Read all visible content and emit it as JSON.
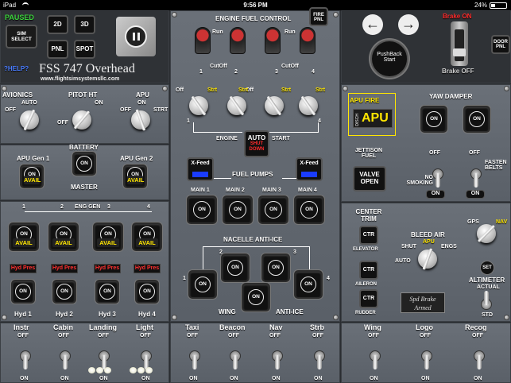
{
  "status": {
    "device": "iPad",
    "wifi": "wifi-icon",
    "time": "9:56 PM",
    "battery": "24%"
  },
  "left": {
    "paused": "PAUSED",
    "sim_select": "SIM SELECT",
    "b2d": "2D",
    "b3d": "3D",
    "pnl": "PNL",
    "spot": "SPOT",
    "help": "?HELP?",
    "title": "FSS 747 Overhead",
    "url": "www.flightsimsystemsllc.com",
    "avionics": "AVIONICS",
    "auto": "AUTO",
    "off": "OFF",
    "on": "ON",
    "pitot": "PITOT HT",
    "apu": "APU",
    "strt": "STRT",
    "apu_gen1": "APU Gen 1",
    "apu_gen2": "APU Gen 2",
    "battery": "BATTERY",
    "master": "MASTER",
    "avail": "AVAIL",
    "eng_gen": "ENG GEN",
    "nums": [
      "1",
      "2",
      "3",
      "4"
    ],
    "hyd_pres": "Hyd Pres",
    "hyd": [
      "Hyd 1",
      "Hyd 2",
      "Hyd 3",
      "Hyd 4"
    ]
  },
  "mid": {
    "fire_pnl": "FIRE PNL",
    "eng_fuel": "ENGINE FUEL CONTROL",
    "run": "Run",
    "cutoff": "CutOff",
    "off": "Off",
    "strt": "Strt",
    "nums": [
      "1",
      "2",
      "3",
      "4"
    ],
    "engine": "ENGINE",
    "start": "START",
    "auto": "AUTO",
    "shutdown": "SHUT DOWN",
    "xfeed": "X-Feed",
    "fuel_pumps": "FUEL PUMPS",
    "mains": [
      "MAIN 1",
      "MAIN 2",
      "MAIN 3",
      "MAIN 4"
    ],
    "nacelle": "NACELLE ANTI-ICE",
    "wing": "WING",
    "anti_ice": "ANTI-ICE",
    "on": "ON"
  },
  "right": {
    "brake_on": "Brake ON",
    "brake_off": "Brake OFF",
    "pushback": "PushBack Start",
    "door_pnl": "DOOR PNL",
    "apu_fire": "APU FIRE",
    "disch": "DISCH",
    "apu": "APU",
    "yaw_damper": "YAW DAMPER",
    "jettison": "JETTISON FUEL",
    "valve_open": "VALVE OPEN",
    "off": "OFF",
    "no_smoking": "NO SMOKING",
    "fasten_belts": "FASTEN BELTS",
    "on": "ON",
    "center_trim": "CENTER TRIM",
    "ctr": "CTR",
    "elevator": "ELEVATOR",
    "aileron": "AILERON",
    "rudder": "RUDDER",
    "bleed_air": "BLEED AIR",
    "shut": "SHUT",
    "apu_lbl": "APU",
    "engs": "ENGS",
    "auto": "AUTO",
    "gps": "GPS",
    "nav": "NAV",
    "set": "SET",
    "altimeter": "ALTIMETER",
    "actual": "ACTUAL",
    "std": "STD",
    "spd_brake": "Spd Brake",
    "armed": "Armed"
  },
  "bottom": {
    "switches": [
      {
        "name": "Instr",
        "off": "OFF",
        "on": "ON"
      },
      {
        "name": "Cabin",
        "off": "OFF",
        "on": "ON"
      },
      {
        "name": "Landing",
        "off": "OFF",
        "on": "ON"
      },
      {
        "name": "Light",
        "off": "OFF",
        "on": "ON"
      },
      {
        "name": "Taxi",
        "off": "OFF",
        "on": "ON"
      },
      {
        "name": "Beacon",
        "off": "OFF",
        "on": "ON"
      },
      {
        "name": "Nav",
        "off": "OFF",
        "on": "ON"
      },
      {
        "name": "Strb",
        "off": "OFF",
        "on": "ON"
      },
      {
        "name": "Wing",
        "off": "OFF",
        "on": "ON"
      },
      {
        "name": "Logo",
        "off": "OFF",
        "on": "ON"
      },
      {
        "name": "Recog",
        "off": "OFF",
        "on": "ON"
      }
    ]
  },
  "colors": {
    "panel": "#61676f",
    "avail": "#ffe600",
    "warn": "#ff2a2a",
    "apu_fire": "#ffe600",
    "gps_nav": "#ffe600"
  }
}
